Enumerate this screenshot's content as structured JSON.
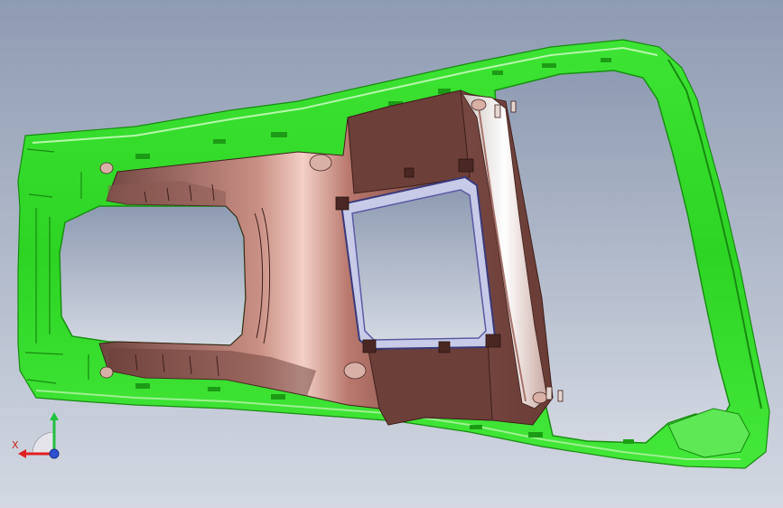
{
  "viewport": {
    "background_top": "#8e9bb2",
    "background_bottom": "#d3d8e2"
  },
  "model": {
    "frame_color": "#33e02a",
    "frame_dark": "#1c9c14",
    "frame_light": "#a8f59d",
    "tray_color": "#7a4a44",
    "tray_highlight": "#e6b9ad",
    "tray_dark": "#5a302b",
    "rail_color": "#ece7e4",
    "window_color": "#b4b8e4"
  },
  "triad": {
    "x_label": "X",
    "x_color": "#e02020",
    "y_color": "#20c040",
    "z_color": "#3050d0"
  }
}
